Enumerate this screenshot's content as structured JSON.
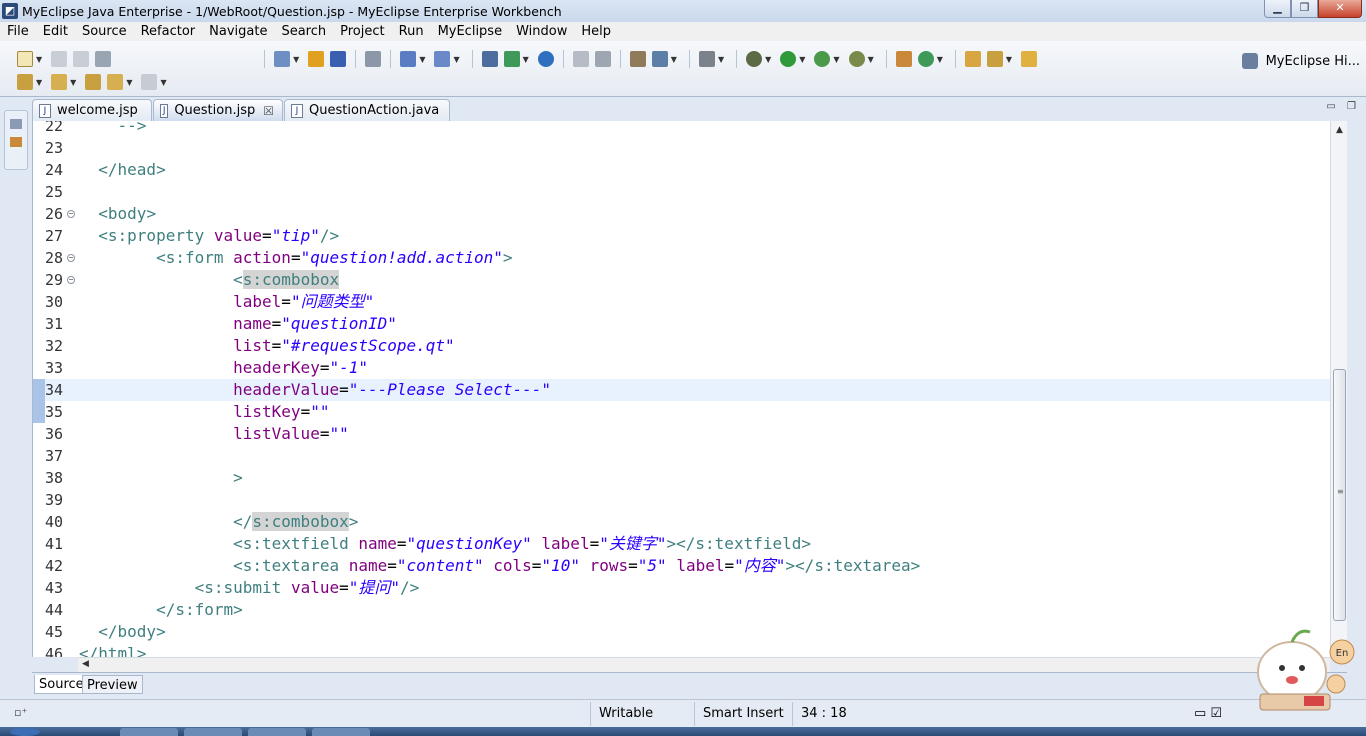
{
  "window": {
    "title": "MyEclipse Java Enterprise - 1/WebRoot/Question.jsp - MyEclipse Enterprise Workbench",
    "minimize": "▁",
    "maximize": "❐",
    "close": "✕"
  },
  "menu": {
    "items": [
      "File",
      "Edit",
      "Source",
      "Refactor",
      "Navigate",
      "Search",
      "Project",
      "Run",
      "MyEclipse",
      "Window",
      "Help"
    ]
  },
  "perspective": {
    "label": "MyEclipse Hi..."
  },
  "tabs": [
    {
      "label": "welcome.jsp",
      "active": false
    },
    {
      "label": "Question.jsp",
      "active": true,
      "close": "☒"
    },
    {
      "label": "QuestionAction.java",
      "active": false
    }
  ],
  "editor": {
    "lines": [
      {
        "n": "22",
        "code": "    -->"
      },
      {
        "n": "23",
        "code": ""
      },
      {
        "n": "24",
        "code": "  </head>"
      },
      {
        "n": "25",
        "code": ""
      },
      {
        "n": "26",
        "code": "  <body>"
      },
      {
        "n": "27",
        "code": "  <s:property value=\"tip\"/>"
      },
      {
        "n": "28",
        "code": "        <s:form action=\"question!add.action\">"
      },
      {
        "n": "29",
        "code": "                <s:combobox"
      },
      {
        "n": "30",
        "code": "                label=\"问题类型\""
      },
      {
        "n": "31",
        "code": "                name=\"questionID\""
      },
      {
        "n": "32",
        "code": "                list=\"#requestScope.qt\""
      },
      {
        "n": "33",
        "code": "                headerKey=\"-1\""
      },
      {
        "n": "34",
        "code": "                headerValue=\"---Please Select---\""
      },
      {
        "n": "35",
        "code": "                listKey=\"\""
      },
      {
        "n": "36",
        "code": "                listValue=\"\""
      },
      {
        "n": "37",
        "code": ""
      },
      {
        "n": "38",
        "code": "                >"
      },
      {
        "n": "39",
        "code": ""
      },
      {
        "n": "40",
        "code": "                </s:combobox>"
      },
      {
        "n": "41",
        "code": "                <s:textfield name=\"questionKey\" label=\"关键字\"></s:textfield>"
      },
      {
        "n": "42",
        "code": "                <s:textarea name=\"content\" cols=\"10\" rows=\"5\" label=\"内容\"></s:textarea>"
      },
      {
        "n": "43",
        "code": "            <s:submit value=\"提问\"/>"
      },
      {
        "n": "44",
        "code": "        </s:form>"
      },
      {
        "n": "45",
        "code": "  </body>"
      },
      {
        "n": "46",
        "code": "</html>"
      }
    ],
    "current_line": "34"
  },
  "bottom_tabs": [
    "Source",
    "Preview"
  ],
  "status": {
    "writable": "Writable",
    "insert_mode": "Smart Insert",
    "position": "34 : 18"
  },
  "mascot_badge": "En",
  "colors": {
    "tag": "#3f7f7f",
    "attribute": "#7f007f",
    "value": "#2a00ff",
    "current_line": "#e8f2fe"
  }
}
